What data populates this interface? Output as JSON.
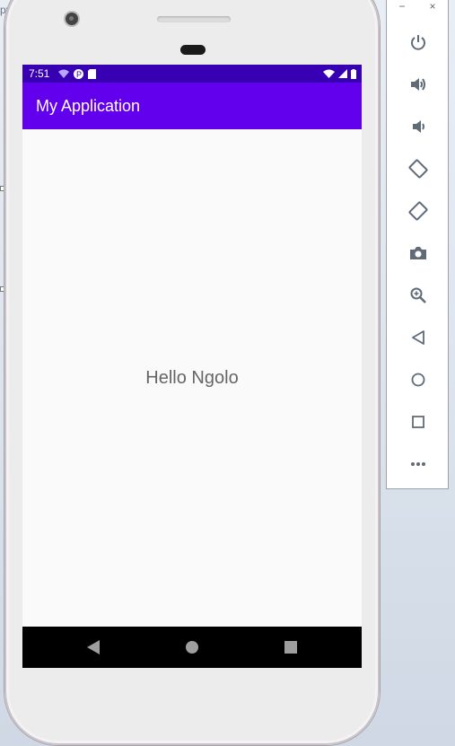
{
  "background": {
    "text": "py"
  },
  "status_bar": {
    "time": "7:51"
  },
  "app_bar": {
    "title": "My Application"
  },
  "content": {
    "text": "Hello Ngolo"
  },
  "emulator_toolbar": {
    "window_controls": [
      "−",
      "×"
    ],
    "buttons": [
      "power-icon",
      "volume-up-icon",
      "volume-down-icon",
      "rotate-left-icon",
      "rotate-right-icon",
      "camera-icon",
      "zoom-icon",
      "back-icon",
      "home-icon",
      "overview-icon",
      "more-icon"
    ]
  },
  "colors": {
    "status_bar": "#3700b3",
    "app_bar": "#6200ee",
    "toolbar_icon": "#5f6b78"
  }
}
